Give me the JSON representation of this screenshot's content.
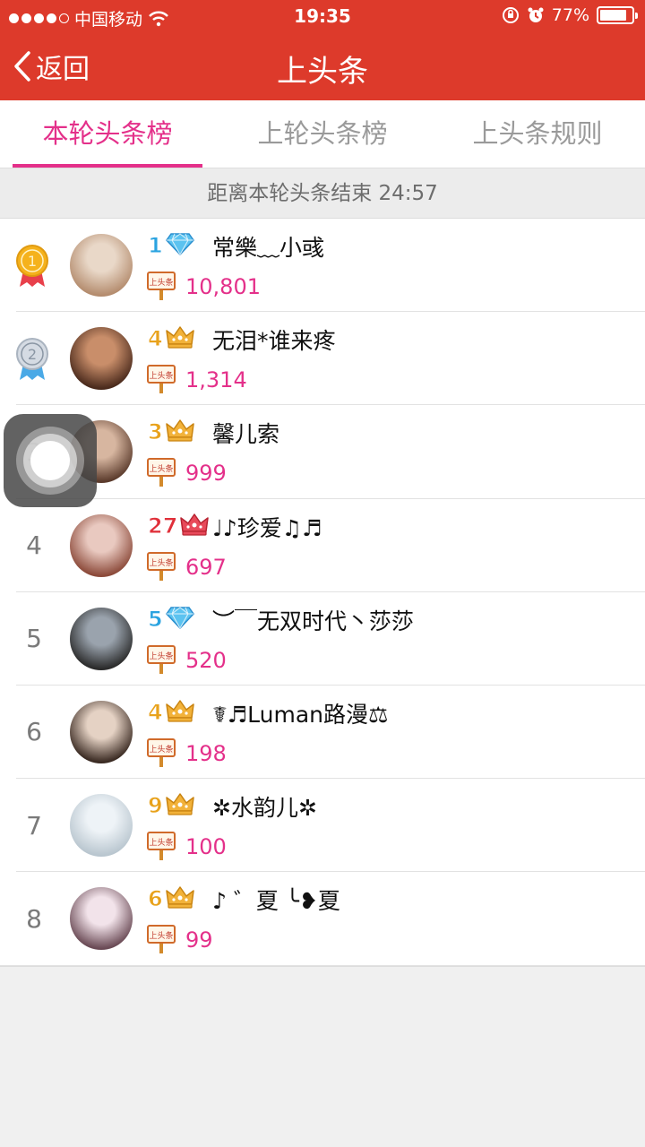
{
  "status_bar": {
    "carrier": "中国移动",
    "time": "19:35",
    "battery": "77%",
    "battery_level": 0.77
  },
  "nav": {
    "back_label": "返回",
    "title": "上头条"
  },
  "tabs": [
    {
      "label": "本轮头条榜",
      "active": true
    },
    {
      "label": "上轮头条榜",
      "active": false
    },
    {
      "label": "上头条规则",
      "active": false
    }
  ],
  "countdown": "距离本轮头条结束 24:57",
  "sign_text": "上头条",
  "entries": [
    {
      "rank": "1",
      "level": "1",
      "badge": "diamond-icon",
      "name": "常樂﹏小彧",
      "score": "10,801"
    },
    {
      "rank": "2",
      "level": "4",
      "badge": "crown-icon",
      "name": "无泪*谁来疼",
      "score": "1,314"
    },
    {
      "rank": "3",
      "level": "3",
      "badge": "crown-icon",
      "name": "馨儿索",
      "score": "999"
    },
    {
      "rank": "4",
      "level": "27",
      "badge": "red-crown-icon",
      "name": "♩♪珍爱♫♬",
      "score": "697"
    },
    {
      "rank": "5",
      "level": "5",
      "badge": "diamond-icon",
      "name": "︶￣无双时代丶莎莎",
      "score": "520"
    },
    {
      "rank": "6",
      "level": "4",
      "badge": "crown-icon",
      "name": "☤♬Luman路漫⚖",
      "score": "198"
    },
    {
      "rank": "7",
      "level": "9",
      "badge": "crown-icon",
      "name": "✲水韵儿✲",
      "score": "100"
    },
    {
      "rank": "8",
      "level": "6",
      "badge": "crown-icon",
      "name": "♪ ゛夏 ╰❥夏",
      "score": "99"
    }
  ],
  "colors": {
    "header": "#dd3a2b",
    "accent_pink": "#e4308a",
    "diamond_blue": "#2aa3e0",
    "crown_gold": "#e8a21c",
    "crown_red": "#e0303a"
  }
}
